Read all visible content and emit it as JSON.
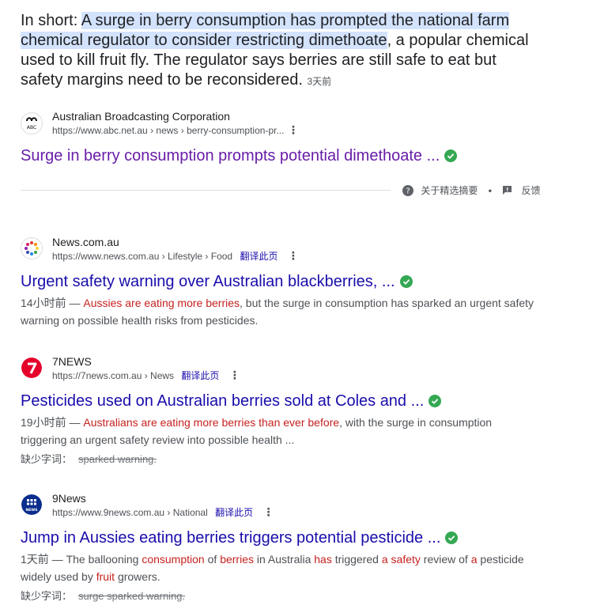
{
  "featured": {
    "prefix": "In short: ",
    "highlight_1": "A surge in berry consumption has prompted the national farm",
    "highlight_2": "chemical regulator to consider restricting dimethoate",
    "rest_1": ", a popular chemical",
    "rest_2": "used to kill fruit fly. The regulator says berries are still safe to eat but",
    "rest_3": "safety margins need to be reconsidered.",
    "age": "3天前",
    "source_name": "Australian Broadcasting Corporation",
    "source_url": "https://www.abc.net.au › news › berry-consumption-pr...",
    "favicon_text": "ABC",
    "title": "Surge in berry consumption prompts potential dimethoate ...",
    "about_label": "关于精选摘要",
    "feedback_label": "反馈"
  },
  "results": [
    {
      "site": "News.com.au",
      "url": "https://www.news.com.au › Lifestyle › Food",
      "translate": "翻译此页",
      "title": "Urgent safety warning over Australian blackberries, ...",
      "age": "14小时前 — ",
      "desc_em": "Aussies are eating more berries",
      "desc_rest": ", but the surge in consumption has sparked an urgent safety warning on possible health risks from pesticides."
    },
    {
      "site": "7NEWS",
      "url": "https://7news.com.au › News",
      "translate": "翻译此页",
      "title": "Pesticides used on Australian berries sold at Coles and ...",
      "age": "19小时前 — ",
      "desc_em": "Australians are eating more berries than ever before",
      "desc_rest": ", with the surge in consumption triggering an urgent safety review into possible health ...",
      "missing_label": "缺少字词：",
      "missing_words": "sparked warning."
    },
    {
      "site": "9News",
      "url": "https://www.9news.com.au › National",
      "translate": "翻译此页",
      "title": "Jump in Aussies eating berries triggers potential pesticide ...",
      "age": "1天前 — ",
      "desc_p1": "The ballooning ",
      "desc_e1": "consumption",
      "desc_p2": " of ",
      "desc_e2": "berries",
      "desc_p3": " in Australia ",
      "desc_e3": "has",
      "desc_p4": " triggered ",
      "desc_e4": "a safety",
      "desc_p5": " review of ",
      "desc_e5": "a",
      "desc_p6": " pesticide widely used by ",
      "desc_e6": "fruit",
      "desc_p7": " growers.",
      "missing_label": "缺少字词：",
      "missing_words": "surge sparked warning."
    }
  ],
  "colors": {
    "link": "#1a0dab",
    "visited": "#681da8",
    "emphasis": "#c5221f",
    "highlight": "#d3e3fd",
    "verified": "#34a853"
  }
}
